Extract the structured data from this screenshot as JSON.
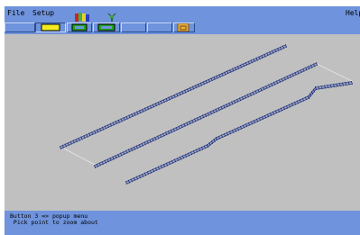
{
  "menubar": {
    "items": [
      "File",
      "Setup"
    ],
    "help_label": "Help"
  },
  "toolbar": {
    "buttons": [
      {
        "icon": "yellow-rectangle-icon",
        "state": "selected"
      },
      {
        "icon": "green-rectangle-icon"
      },
      {
        "icon": "green-rectangle-icon"
      },
      {
        "icon": "blank"
      },
      {
        "icon": "blank"
      },
      {
        "icon": "folder-icon"
      }
    ]
  },
  "status": {
    "line1": "Button 3 => popup menu",
    "line2": " Pick point to zoom about"
  },
  "colors": {
    "panel": "#6f93dc",
    "canvas": "#c0c0c0",
    "wire": "#1c2a6e"
  }
}
